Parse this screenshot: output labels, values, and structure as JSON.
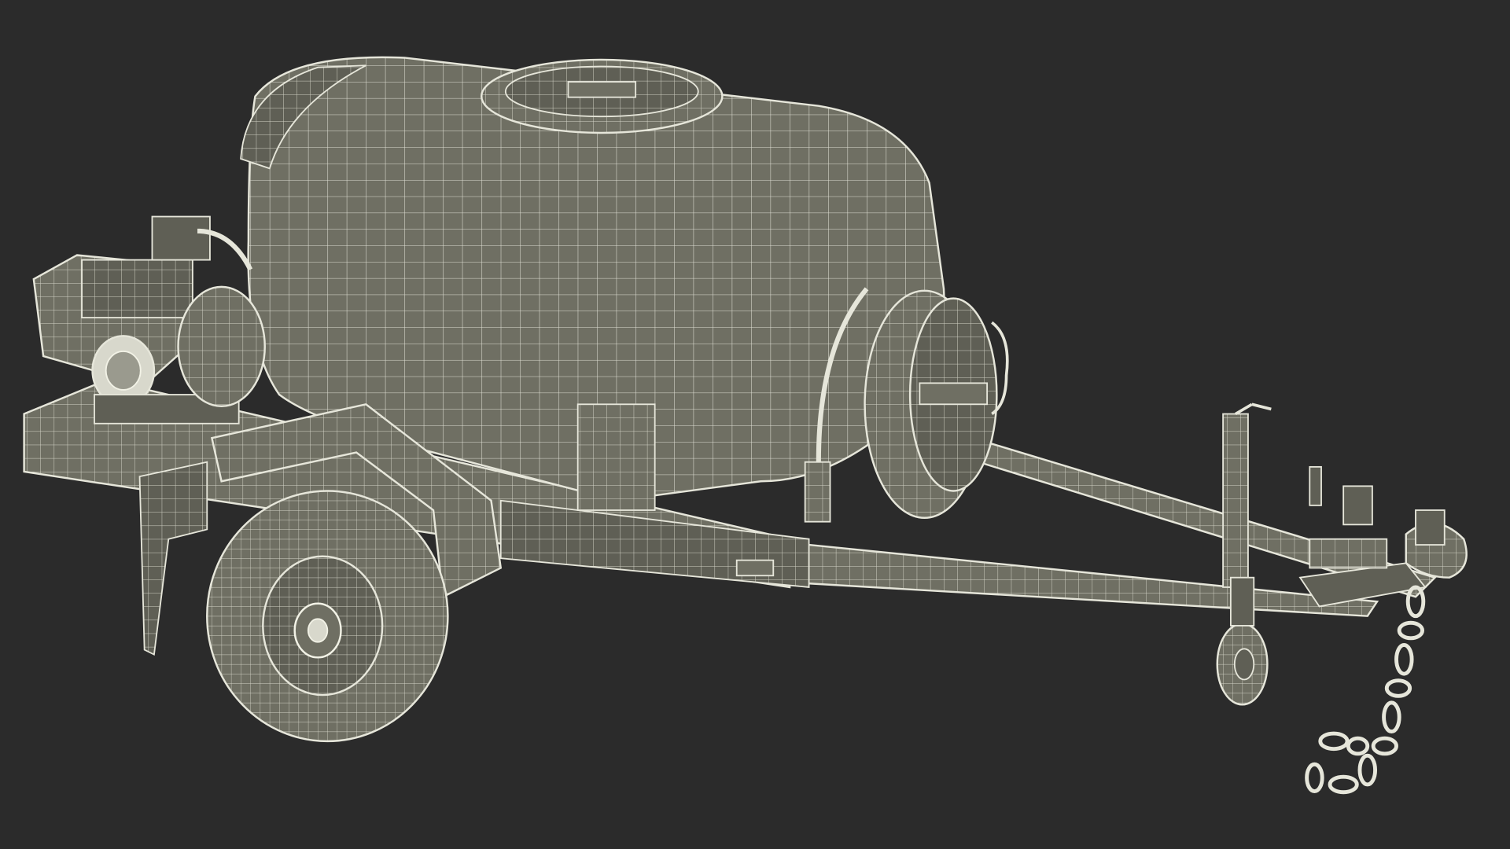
{
  "scene": {
    "background_color": "#2b2b2b",
    "surface_color": "#6f6f63",
    "surface_dark_color": "#5f5f55",
    "wire_color": "#e6e6da",
    "wire_color_dim": "#cfcfc2",
    "objects": [
      "water-tank",
      "tank-lid",
      "petrol-engine",
      "water-pump",
      "hose-reel",
      "trailer-frame",
      "mudguard",
      "wheel",
      "a-frame-drawbar",
      "jockey-wheel",
      "tow-hitch",
      "safety-chain"
    ]
  }
}
